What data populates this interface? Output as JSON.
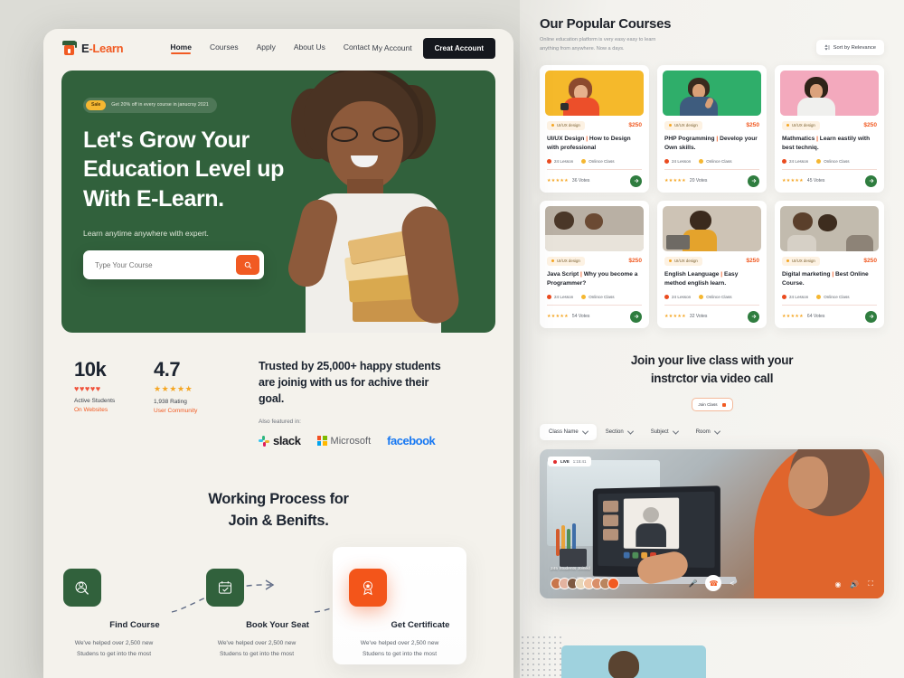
{
  "brand": {
    "name_prefix": "E",
    "name": "E-Learn",
    "accent": "#f15a22",
    "green": "#31613c"
  },
  "header": {
    "nav": [
      {
        "label": "Home",
        "active": true
      },
      {
        "label": "Courses",
        "active": false
      },
      {
        "label": "Apply",
        "active": false
      },
      {
        "label": "About Us",
        "active": false
      },
      {
        "label": "Contact",
        "active": false
      }
    ],
    "my_account": "My Account",
    "create_account": "Creat Account"
  },
  "hero": {
    "badge_pill": "Sale",
    "badge_text": "Get 20% off in every course in janucrsy 2021",
    "heading_line1": "Let's Grow Your",
    "heading_line2": "Education Level up",
    "heading_line3": "With  E-Learn.",
    "subtitle": "Learn anytime anywhere with expert.",
    "search_placeholder": "Type Your Course",
    "search_icon": "search-icon"
  },
  "stats": {
    "items": [
      {
        "number": "10k",
        "icons": "♥♥♥♥♥",
        "icon_type": "hearts",
        "line1": "Active Students",
        "line2": "On Websites"
      },
      {
        "number": "4.7",
        "icons": "★★★★★",
        "icon_type": "stars",
        "line1": "1,938 Rating",
        "line2": "User Community"
      }
    ],
    "trust_heading": "Trusted by 25,000+ happy students are joinig with us for achive their goal.",
    "also_featured": "Also featured in:",
    "brands": [
      "slack",
      "Microsoft",
      "facebook"
    ]
  },
  "working_process": {
    "heading_line1": "Working Process for",
    "heading_line2": "Join & Benifts.",
    "steps": [
      {
        "title": "Find Course",
        "desc": "We've helped over 2,500 new Studens to get into the most",
        "icon": "user-search-icon",
        "highlight": false
      },
      {
        "title": "Book Your Seat",
        "desc": "We've helped over 2,500 new Studens to get into the most",
        "icon": "calendar-check-icon",
        "highlight": false
      },
      {
        "title": "Get Certificate",
        "desc": "We've helped over 2,500 new Studens to get into the most",
        "icon": "award-badge-icon",
        "highlight": true
      }
    ]
  },
  "courses_panel": {
    "heading": "Our Popular Courses",
    "subtitle": "Online education platform is very easy easy to learn anything from anywhere. Now a days.",
    "sort_label": "Sort by Relevance",
    "sort_icon": "sort-icon",
    "cards": [
      {
        "tag": "UI/UX design",
        "price": "$250",
        "title_main": "UI/UX Design",
        "title_rest": "How to Design with professional",
        "lesson": "24 Lesson",
        "mode": "Onlince Class",
        "stars": "★★★★★",
        "votes": "36 Votes",
        "img": "woman-orange-yellow"
      },
      {
        "tag": "UI/UX design",
        "price": "$250",
        "title_main": "PHP Pogramming",
        "title_rest": "Develop your Own skills.",
        "lesson": "24 Lesson",
        "mode": "Onlince Class",
        "stars": "★★★★★",
        "votes": "20 Votes",
        "img": "man-green"
      },
      {
        "tag": "UI/UX design",
        "price": "$250",
        "title_main": "Mathmatics",
        "title_rest": "Learn eastily with best techniq.",
        "lesson": "24 Lesson",
        "mode": "Onlince Class",
        "stars": "★★★★★",
        "votes": "45 Votes",
        "img": "woman-pink"
      },
      {
        "tag": "UI/UX design",
        "price": "$250",
        "title_main": "Java Script",
        "title_rest": "Why you become a Programmer?",
        "lesson": "24 Lesson",
        "mode": "Onlince Class",
        "stars": "★★★★★",
        "votes": "54 Votes",
        "img": "study-desk"
      },
      {
        "tag": "UI/UX design",
        "price": "$250",
        "title_main": "English Leanguage",
        "title_rest": "Easy method english learn.",
        "lesson": "24 Lesson",
        "mode": "Onlince Class",
        "stars": "★★★★★",
        "votes": "32 Votes",
        "img": "laptop-woman"
      },
      {
        "tag": "UI/UX design",
        "price": "$250",
        "title_main": "Digital marketing",
        "title_rest": "Best Online  Course.",
        "lesson": "24 Lesson",
        "mode": "Onlince Class",
        "stars": "★★★★★",
        "votes": "64 Votes",
        "img": "two-women"
      }
    ]
  },
  "live_class": {
    "heading_line1": "Join your live class with your",
    "heading_line2": "instrctor via video call",
    "join_button": "Join Class",
    "filters": [
      {
        "label": "Class Name",
        "selected": true
      },
      {
        "label": "Section",
        "selected": false
      },
      {
        "label": "Subject",
        "selected": false
      },
      {
        "label": "Room",
        "selected": false
      }
    ],
    "video": {
      "live_label": "LIVE",
      "live_time": "1:15:41",
      "joined_text": "245 Students Joined",
      "controls": [
        "mic-icon",
        "end-call-icon",
        "share-icon",
        "settings-icon",
        "volume-icon",
        "fullscreen-icon"
      ]
    }
  }
}
